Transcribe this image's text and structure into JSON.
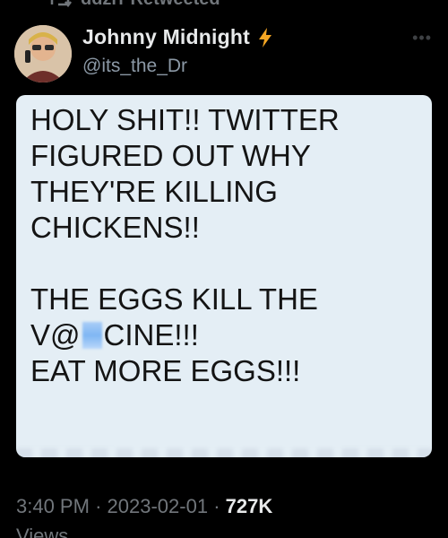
{
  "retweet": {
    "label": "ddzrr Retweeted",
    "icon": "retweet-icon"
  },
  "author": {
    "display_name": "Johnny Midnight",
    "handle": "@its_the_Dr",
    "badge_icon": "lightning-icon",
    "badge_color": "#f5a623"
  },
  "more_icon": "more-options-icon",
  "tweet": {
    "lines": [
      "HOLY SHIT!! TWITTER",
      "FIGURED OUT WHY",
      "THEY'RE KILLING",
      "CHICKENS!!",
      "",
      "THE EGGS KILL THE",
      "",
      "EAT MORE EGGS!!!"
    ],
    "censored_line": {
      "prefix": "V@",
      "suffix": "CINE!!!"
    }
  },
  "meta": {
    "time": "3:40 PM",
    "separator": "·",
    "date": "2023-02-01",
    "views_count": "727K",
    "views_label": "Views"
  },
  "colors": {
    "background": "#000000",
    "card": "#e4eef5",
    "muted_text": "#71767b"
  }
}
